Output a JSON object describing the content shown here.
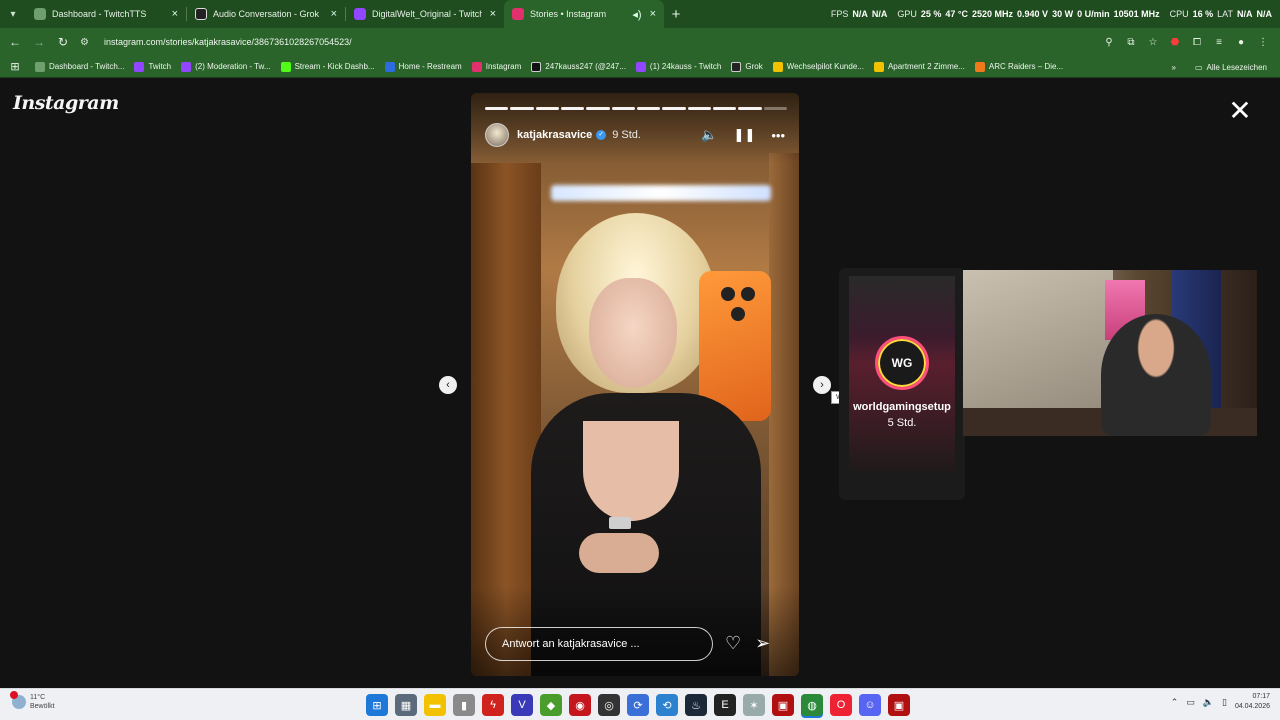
{
  "browser": {
    "tabs": [
      {
        "title": "Dashboard - TwitchTTS",
        "icon": "twitchtts-icon",
        "color": "#6f9f6f",
        "active": false
      },
      {
        "title": "Audio Conversation - Grok",
        "icon": "grok-icon",
        "color": "#222222",
        "active": false
      },
      {
        "title": "DigitalWelt_Original - Twitch",
        "icon": "twitch-icon",
        "color": "#9146ff",
        "active": false
      },
      {
        "title": "Stories • Instagram",
        "icon": "instagram-icon",
        "color": "#e1306c",
        "active": true
      }
    ],
    "overlay": {
      "fps_label": "FPS",
      "fps_value": "N/A",
      "fps_value2": "N/A",
      "gpu_label": "GPU",
      "gpu_load": "25 %",
      "gpu_temp": "47 °C",
      "gpu_clock": "2520 MHz",
      "gpu_volt": "0.940 V",
      "gpu_power": "30 W",
      "gpu_fan": "0 U/min",
      "gpu_mem": "10501 MHz",
      "cpu_label": "CPU",
      "cpu_load": "16 %",
      "lat_label": "LAT",
      "lat_value": "N/A",
      "lat_value2": "N/A"
    },
    "url": "instagram.com/stories/katjakrasavice/3867361028267054523/",
    "bookmarks": [
      {
        "label": "Dashboard - Twitch...",
        "color": "#6f9f6f"
      },
      {
        "label": "Twitch",
        "color": "#9146ff"
      },
      {
        "label": "(2) Moderation - Tw...",
        "color": "#9146ff"
      },
      {
        "label": "Stream - Kick Dashb...",
        "color": "#53fc18"
      },
      {
        "label": "Home - Restream",
        "color": "#2d6cdf"
      },
      {
        "label": "Instagram",
        "color": "#e1306c"
      },
      {
        "label": "247kauss247 (@247...",
        "color": "#111111"
      },
      {
        "label": "(1) 24kauss - Twitch",
        "color": "#9146ff"
      },
      {
        "label": "Grok",
        "color": "#222222"
      },
      {
        "label": "Wechselpilot Kunde...",
        "color": "#f2c200"
      },
      {
        "label": "Apartment 2 Zimme...",
        "color": "#f2c200"
      },
      {
        "label": "ARC Raiders – Die...",
        "color": "#f07a1a"
      }
    ],
    "bookmarks_more": "»",
    "all_bookmarks": "Alle Lesezeichen"
  },
  "instagram": {
    "logo": "Instagram",
    "story": {
      "username": "katjakrasavice",
      "age": "9 Std.",
      "progress_total": 12,
      "progress_done": 11,
      "reply_placeholder": "Antwort an katjakrasavice ..."
    },
    "next_story": {
      "username": "worldgamingsetup",
      "age": "5 Std.",
      "logo_text": "WG"
    },
    "tooltip": "Weiter"
  },
  "taskbar": {
    "weather_temp": "11°C",
    "weather_desc": "Bewölkt",
    "time": "07:17",
    "date": "04.04.2026"
  },
  "colors": {
    "browser_dark": "#1f4d1f",
    "browser_light": "#2a642a",
    "page_bg": "#121212",
    "ig_blue": "#3897f0"
  }
}
